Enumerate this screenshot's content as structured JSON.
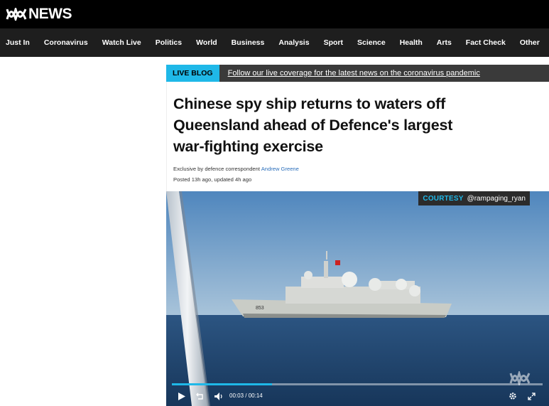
{
  "header": {
    "logo_text": "NEWS",
    "logo_icon": "abc-logo-icon"
  },
  "nav": {
    "items": [
      "Just In",
      "Coronavirus",
      "Watch Live",
      "Politics",
      "World",
      "Business",
      "Analysis",
      "Sport",
      "Science",
      "Health",
      "Arts",
      "Fact Check",
      "Other"
    ]
  },
  "banner": {
    "tag": "LIVE BLOG",
    "text": "Follow our live coverage for the latest news on the coronavirus pandemic"
  },
  "article": {
    "headline": "Chinese spy ship returns to waters off Queensland ahead of Defence's largest war-fighting exercise",
    "byline_prefix": "Exclusive by defence correspondent ",
    "author": "Andrew Greene",
    "posted": "Posted 13h ago, updated 4h ago"
  },
  "video": {
    "courtesy_label": "COURTESY",
    "courtesy_handle": "@rampaging_ryan",
    "current_time": "00:03",
    "separator": "/",
    "duration": "00:14",
    "progress_fraction": 0.27,
    "ship_hull_number": "853",
    "accent_color": "#1fb8e8",
    "icons": {
      "play": "play-icon",
      "replay": "replay-icon",
      "volume": "volume-icon",
      "settings": "gear-icon",
      "fullscreen": "fullscreen-icon"
    }
  },
  "colors": {
    "topbar": "#000000",
    "navbar": "#1e1e1e",
    "accent": "#1fb8e8",
    "link": "#2a6ebb"
  }
}
